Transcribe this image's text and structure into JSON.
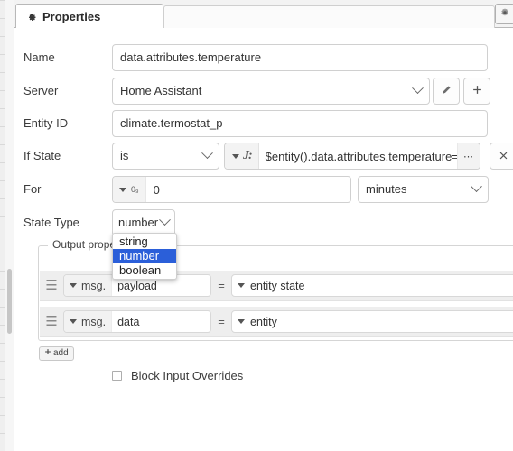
{
  "window": {
    "tab_label": "Properties",
    "tab_icon": "gear-icon",
    "settings_icon": "gear-icon"
  },
  "form": {
    "name": {
      "label": "Name",
      "value": "data.attributes.temperature"
    },
    "server": {
      "label": "Server",
      "value": "Home Assistant",
      "edit_icon": "pencil-icon",
      "add_icon": "plus-icon"
    },
    "entity_id": {
      "label": "Entity ID",
      "value": "climate.termostat_p"
    },
    "if_state": {
      "label": "If State",
      "operator": "is",
      "value_type": "JSONata",
      "value_type_glyph": "J:",
      "value": "$entity().data.attributes.temperature=temp",
      "expand_icon": "ellipsis-icon",
      "clear_icon": "close-icon"
    },
    "for": {
      "label": "For",
      "type_glyph": "0₉",
      "value": "0",
      "units": "minutes"
    },
    "state_type": {
      "label": "State Type",
      "value": "number",
      "options": [
        "string",
        "number",
        "boolean"
      ],
      "selected": "number",
      "open": true
    }
  },
  "output_properties": {
    "legend": "Output properties",
    "add_label": "add",
    "add_icon": "plus-icon",
    "drag_icon": "drag-handle-icon",
    "equals": "=",
    "rows": [
      {
        "prefix": "msg.",
        "key": "payload",
        "value": "entity state"
      },
      {
        "prefix": "msg.",
        "key": "data",
        "value": "entity"
      }
    ]
  },
  "block_input_overrides": {
    "label": "Block Input Overrides",
    "checked": false
  },
  "colors": {
    "highlight": "#2b5fd9",
    "panel_bg": "#ffffff",
    "row_bg": "#eeeeee",
    "border": "#d0d0d0"
  }
}
